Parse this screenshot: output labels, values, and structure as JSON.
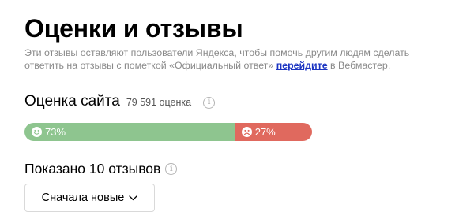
{
  "page": {
    "title": "Оценки и отзывы",
    "description_line1": "Эти отзывы оставляют пользователи Яндекса, чтобы помочь другим людям сделать",
    "description_line2_before": "ответить на отзывы с пометкой «Официальный ответ» ",
    "description_link": "перейдите",
    "description_line2_after": " в Вебмастер."
  },
  "rating": {
    "title": "Оценка сайта",
    "count": "79 591 оценка",
    "info_icon": "info-icon"
  },
  "sentiment": {
    "positive_label": "73%",
    "positive_fraction": 0.73,
    "negative_label": "27%",
    "negative_fraction": 0.27,
    "positive_color": "#8ec58f",
    "negative_color": "#e0695e",
    "positive_icon": "smile-icon",
    "negative_icon": "sad-face-icon"
  },
  "reviews": {
    "shown_text": "Показано 10 отзывов",
    "info_icon": "info-icon"
  },
  "sort": {
    "label": "Сначала новые",
    "icon": "chevron-down-icon"
  },
  "colors": {
    "link": "#1b34c2",
    "muted_text": "#8a8a8a"
  }
}
